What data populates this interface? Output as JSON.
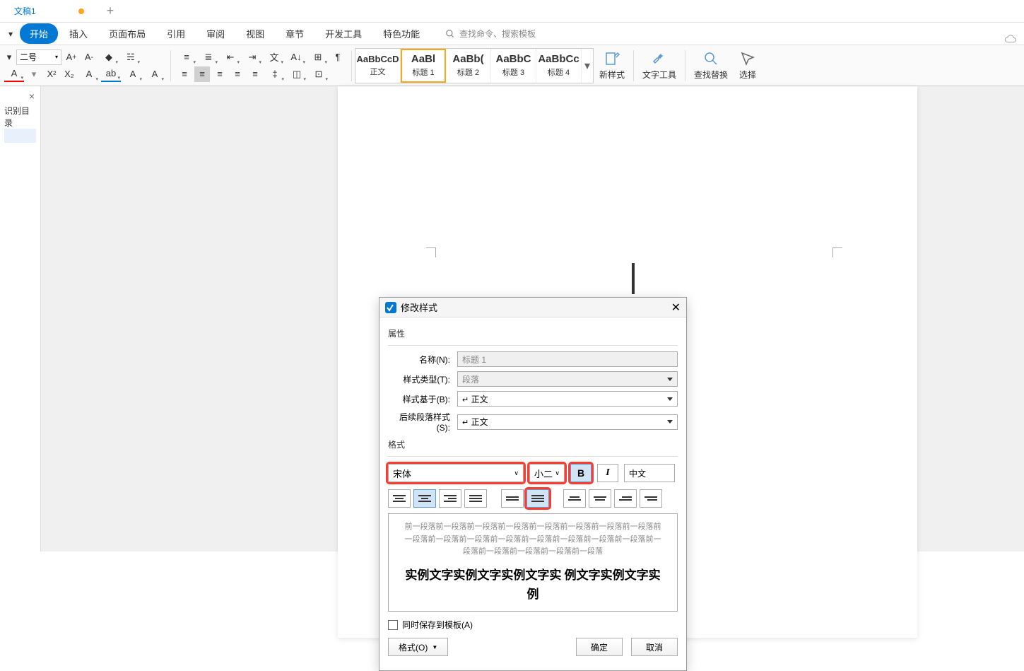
{
  "tabs": {
    "doc": "文稿1"
  },
  "menu": {
    "file_arrow": "▾",
    "items": [
      "开始",
      "插入",
      "页面布局",
      "引用",
      "审阅",
      "视图",
      "章节",
      "开发工具",
      "特色功能"
    ],
    "search_placeholder": "查找命令、搜索模板"
  },
  "toolbar": {
    "font_size": "二号",
    "styles": [
      {
        "prev": "AaBbCcD",
        "name": "正文"
      },
      {
        "prev": "AaBl",
        "name": "标题 1"
      },
      {
        "prev": "AaBb(",
        "name": "标题 2"
      },
      {
        "prev": "AaBbC",
        "name": "标题 3"
      },
      {
        "prev": "AaBbCc",
        "name": "标题 4"
      }
    ],
    "new_style": "新样式",
    "text_tools": "文字工具",
    "find_replace": "查找替换",
    "select": "选择"
  },
  "sidebar": {
    "outline": "识别目录"
  },
  "dialog": {
    "title": "修改样式",
    "section_props": "属性",
    "labels": {
      "name": "名称(N):",
      "type": "样式类型(T):",
      "based": "样式基于(B):",
      "next": "后续段落样式(S):"
    },
    "values": {
      "name": "标题 1",
      "type": "段落",
      "based": "正文",
      "next": "正文"
    },
    "section_format": "格式",
    "font": "宋体",
    "size": "小二",
    "bold": "B",
    "italic": "I",
    "lang": "中文",
    "preview_gray": "前一段落前一段落前一段落前一段落前一段落前一段落前一段落前一段落前一段落前一段落前一段落前一段落前一段落前一段落前一段落前一段落前一段落前一段落前一段落前一段落前一段落",
    "preview_sample": "实例文字实例文字实例文字实 例文字实例文字实例",
    "save_template": "同时保存到模板(A)",
    "format_btn": "格式(O)",
    "ok": "确定",
    "cancel": "取消"
  }
}
